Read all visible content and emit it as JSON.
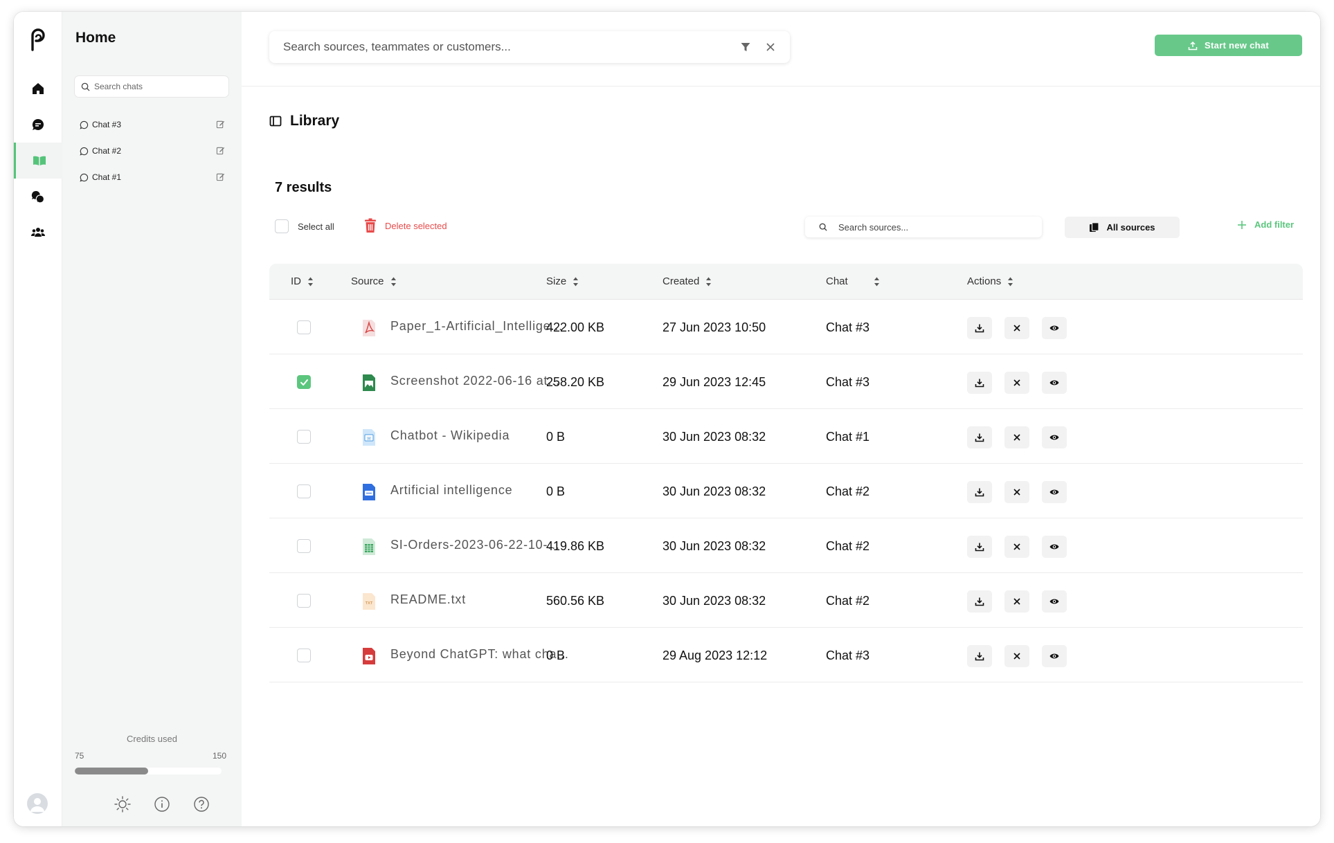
{
  "panel": {
    "title": "Home",
    "search_placeholder": "Search chats",
    "chats": [
      "Chat #3",
      "Chat #2",
      "Chat #1"
    ],
    "credits": {
      "label": "Credits used",
      "used": "75",
      "total": "150",
      "fraction": 0.5
    }
  },
  "rail": {
    "items": [
      "home-icon",
      "chat-icon",
      "library-icon",
      "conversations-icon",
      "team-icon"
    ],
    "active": "library-icon"
  },
  "topbar": {
    "search_placeholder": "Search sources, teammates or customers...",
    "start_button": "Start new chat"
  },
  "library": {
    "title": "Library",
    "results": "7 results",
    "select_all": "Select all",
    "delete_selected": "Delete selected",
    "source_search_placeholder": "Search sources...",
    "all_sources": "All sources",
    "add_filter": "Add filter",
    "columns": [
      "ID",
      "Source",
      "Size",
      "Created",
      "Chat",
      "Actions"
    ],
    "rows": [
      {
        "checked": false,
        "type": "pdf",
        "source": "Paper_1-Artificial_Intellige...",
        "size": "422.00 KB",
        "created": "27 Jun 2023 10:50",
        "chat": "Chat #3"
      },
      {
        "checked": true,
        "type": "image",
        "source": "Screenshot 2022-06-16 at...",
        "size": "258.20 KB",
        "created": "29 Jun 2023 12:45",
        "chat": "Chat #3"
      },
      {
        "checked": false,
        "type": "web",
        "source": "Chatbot - Wikipedia",
        "size": "0 B",
        "created": "30 Jun 2023 08:32",
        "chat": "Chat #1"
      },
      {
        "checked": false,
        "type": "doc",
        "source": "Artificial intelligence",
        "size": "0 B",
        "created": "30 Jun 2023 08:32",
        "chat": "Chat #2"
      },
      {
        "checked": false,
        "type": "sheet",
        "source": "SI-Orders-2023-06-22-10-...",
        "size": "419.86 KB",
        "created": "30 Jun 2023 08:32",
        "chat": "Chat #2"
      },
      {
        "checked": false,
        "type": "txt",
        "source": "README.txt",
        "size": "560.56 KB",
        "created": "30 Jun 2023 08:32",
        "chat": "Chat #2"
      },
      {
        "checked": false,
        "type": "video",
        "source": "Beyond ChatGPT: what cha...",
        "size": "0 B",
        "created": "29 Aug 2023 12:12",
        "chat": "Chat #3"
      }
    ]
  },
  "colors": {
    "accent": "#68c88a",
    "danger": "#e84b4b",
    "panel_bg": "#f4f5f5"
  }
}
